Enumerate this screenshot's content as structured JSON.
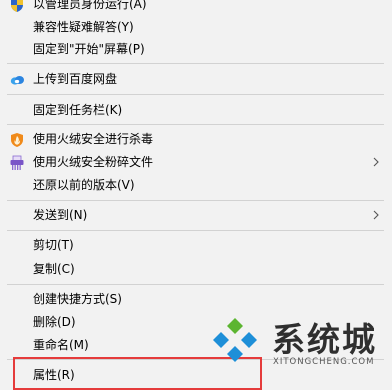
{
  "menu": {
    "items": [
      {
        "label": "以管理员身份运行(A)",
        "icon": "uac-shield-icon"
      },
      {
        "label": "兼容性疑难解答(Y)"
      },
      {
        "label": "固定到\"开始\"屏幕(P)"
      },
      {
        "label": "上传到百度网盘",
        "icon": "baidu-netdisk-icon"
      },
      {
        "label": "固定到任务栏(K)"
      },
      {
        "label": "使用火绒安全进行杀毒",
        "icon": "huorong-shield-icon"
      },
      {
        "label": "使用火绒安全粉碎文件",
        "icon": "shredder-icon",
        "submenu": true
      },
      {
        "label": "还原以前的版本(V)"
      },
      {
        "label": "发送到(N)",
        "submenu": true
      },
      {
        "label": "剪切(T)"
      },
      {
        "label": "复制(C)"
      },
      {
        "label": "创建快捷方式(S)"
      },
      {
        "label": "删除(D)"
      },
      {
        "label": "重命名(M)"
      },
      {
        "label": "属性(R)",
        "highlighted": true
      }
    ]
  },
  "watermark": {
    "title": "系统城",
    "subtitle": "XITONGCHENG.COM",
    "colors": {
      "blue": "#1e8fd8",
      "green": "#5cb531"
    }
  },
  "colors": {
    "highlight_border": "#e53b3b",
    "menu_bg": "#f2f2f2"
  }
}
